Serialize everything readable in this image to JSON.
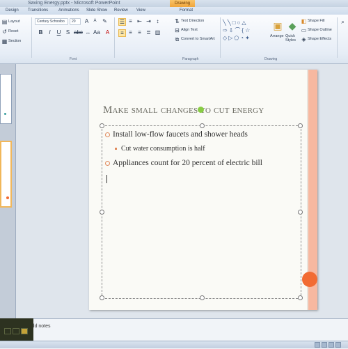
{
  "window": {
    "title": "Saving Energy.pptx - Microsoft PowerPoint",
    "context_tools": "Drawing Tools"
  },
  "tabs": [
    "Design",
    "Transitions",
    "Animations",
    "Slide Show",
    "Review",
    "View",
    "Format"
  ],
  "ribbon": {
    "layout_label": "Layout",
    "reset_label": "Reset",
    "section_label": "Section",
    "font_name": "Century Schoolbo",
    "font_size": "20",
    "font_group": "Font",
    "paragraph_group": "Paragraph",
    "drawing_group": "Drawing",
    "text_direction": "Text Direction",
    "align_text": "Align Text",
    "convert_smartart": "Convert to SmartArt",
    "arrange": "Arrange",
    "quick_styles": "Quick Styles",
    "shape_fill": "Shape Fill",
    "shape_outline": "Shape Outline",
    "shape_effects": "Shape Effects"
  },
  "slide": {
    "title": "Make small changes to cut energy",
    "bullets": [
      {
        "text": "Install low-flow faucets and shower heads",
        "level": 1
      },
      {
        "text": "Cut water consumption is half",
        "level": 2
      },
      {
        "text": "Appliances count for 20 percent of electric bill",
        "level": 1
      }
    ]
  },
  "notes": {
    "placeholder": "to add notes"
  },
  "colors": {
    "accent": "#f26b33",
    "stripe": "#f7b8a0",
    "title_text": "#6b6b62"
  }
}
